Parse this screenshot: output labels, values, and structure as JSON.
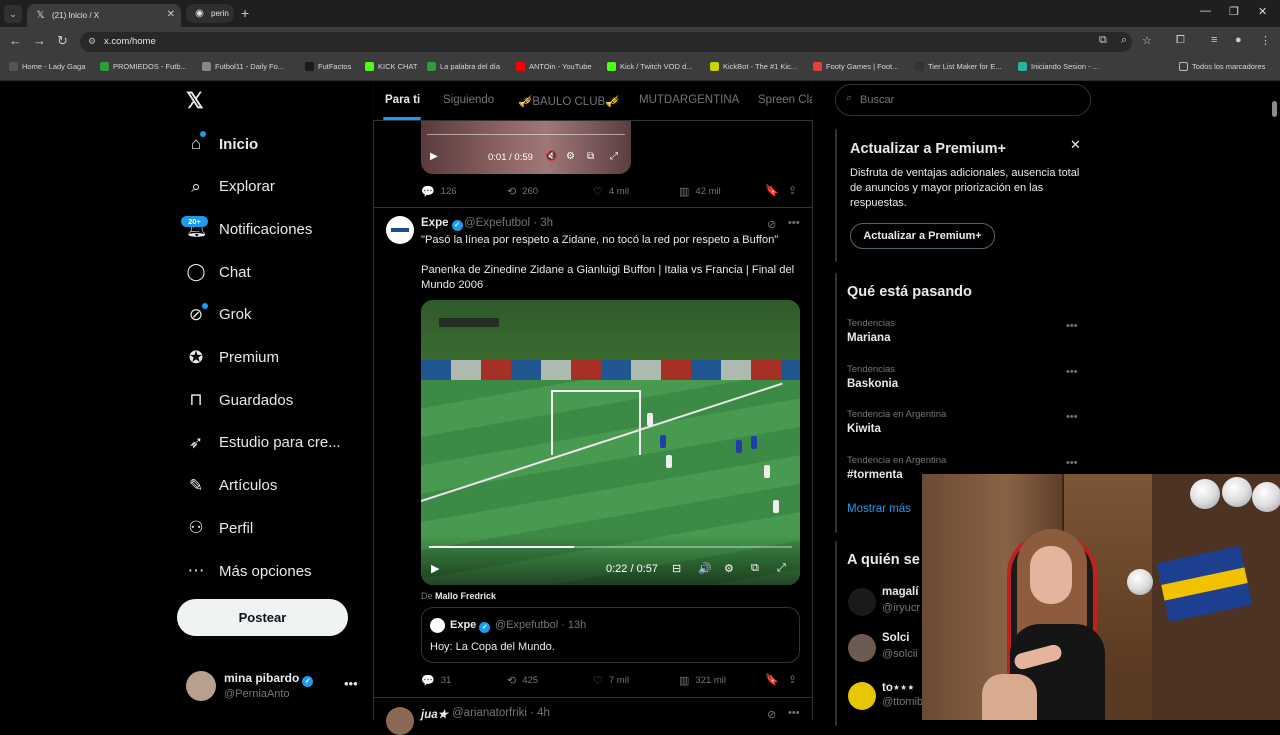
{
  "browser": {
    "tabs": [
      {
        "title": "(21) Inicio / X",
        "favicon": "x-logo-icon",
        "active": true
      },
      {
        "title": "perin",
        "favicon": "chrome-icon",
        "active": false
      }
    ],
    "url": "x.com/home",
    "bookmarks": [
      {
        "label": "Home - Lady Gaga",
        "color": "#555555"
      },
      {
        "label": "PROMIEDOS - Futb...",
        "color": "#2e9e3e"
      },
      {
        "label": "Futbol11 - Daily Fo...",
        "color": "#888888"
      },
      {
        "label": "FutFactos",
        "color": "#1a1a1a"
      },
      {
        "label": "KICK CHAT",
        "color": "#53fc18"
      },
      {
        "label": "La palabra del día",
        "color": "#2e9e3e"
      },
      {
        "label": "ANTOin - YouTube",
        "color": "#ff0000"
      },
      {
        "label": "Kick / Twitch VOD d...",
        "color": "#53fc18"
      },
      {
        "label": "KickBot - The #1 Kic...",
        "color": "#c8d400"
      },
      {
        "label": "Footy Games | Foot...",
        "color": "#e04040"
      },
      {
        "label": "Tier List Maker for E...",
        "color": "#333333"
      },
      {
        "label": "Iniciando Sesion - ...",
        "color": "#2ab3a0"
      }
    ],
    "bookmarks_folder": "Todos los marcadores"
  },
  "sidebar": {
    "logo": "x-logo-icon",
    "items": [
      {
        "label": "Inicio",
        "icon": "home-icon",
        "bold": true
      },
      {
        "label": "Explorar",
        "icon": "search-icon"
      },
      {
        "label": "Notificaciones",
        "icon": "bell-icon"
      },
      {
        "label": "Chat",
        "icon": "chat-icon"
      },
      {
        "label": "Grok",
        "icon": "grok-icon"
      },
      {
        "label": "Premium",
        "icon": "premium-icon"
      },
      {
        "label": "Guardados",
        "icon": "bookmark-icon"
      },
      {
        "label": "Estudio para cre...",
        "icon": "rocket-icon"
      },
      {
        "label": "Artículos",
        "icon": "article-icon"
      },
      {
        "label": "Perfil",
        "icon": "profile-icon"
      },
      {
        "label": "Más opciones",
        "icon": "more-icon"
      }
    ],
    "notif_badge": "20+",
    "post_label": "Postear",
    "user": {
      "name": "mina pibardo",
      "handle": "@PerniaAnto"
    }
  },
  "feed": {
    "tabs": [
      "Para ti",
      "Siguiendo",
      "🎺BAULO CLUB🎺",
      "MUTDARGENTINA",
      "Spreen Cla"
    ],
    "post1": {
      "video_time": "0:01 / 0:59",
      "replies": "126",
      "reposts": "260",
      "likes": "4 mil",
      "views": "42 mil"
    },
    "post2": {
      "name": "Expe",
      "handle_time": "@Expefutbol · 3h",
      "line1": "\"Pasó la línea por respeto a Zidane, no tocó la red por respeto a Buffon\"",
      "line2": "Panenka de Zinedine Zidane a Gianluigi Buffon | Italia vs Francia | Final del Mundo 2006",
      "video_time": "0:22 / 0:57",
      "from_prefix": "De",
      "from_name": "Mallo Fredrick",
      "quote_name": "Expe",
      "quote_handle_time": "@Expefutbol · 13h",
      "quote_text": "Hoy: La Copa del Mundo.",
      "replies": "31",
      "reposts": "425",
      "likes": "7 mil",
      "views": "321 mil"
    },
    "post3": {
      "name": "jua★",
      "handle_time": "@arianatorfriki · 4h"
    }
  },
  "right": {
    "search_placeholder": "Buscar",
    "premium": {
      "title": "Actualizar a Premium+",
      "body": "Disfruta de ventajas adicionales, ausencia total de anuncios y mayor priorización en las respuestas.",
      "button": "Actualizar a Premium+"
    },
    "trends_title": "Qué está pasando",
    "trends": [
      {
        "context": "Tendencias",
        "name": "Mariana"
      },
      {
        "context": "Tendencias",
        "name": "Baskonia"
      },
      {
        "context": "Tendencia en Argentina",
        "name": "Kiwita"
      },
      {
        "context": "Tendencia en Argentina",
        "name": "#tormenta"
      }
    ],
    "show_more": "Mostrar más",
    "who_title": "A quién se",
    "who": [
      {
        "name": "magalí",
        "handle": "@iryucr"
      },
      {
        "name": "Solci",
        "handle": "@solcii"
      },
      {
        "name": "to⋆⋆⋆",
        "handle": "@ttomib"
      }
    ]
  },
  "colors": {
    "accent": "#1d9bf0",
    "bg": "#000000",
    "border": "#2f3336",
    "muted": "#71767b"
  }
}
